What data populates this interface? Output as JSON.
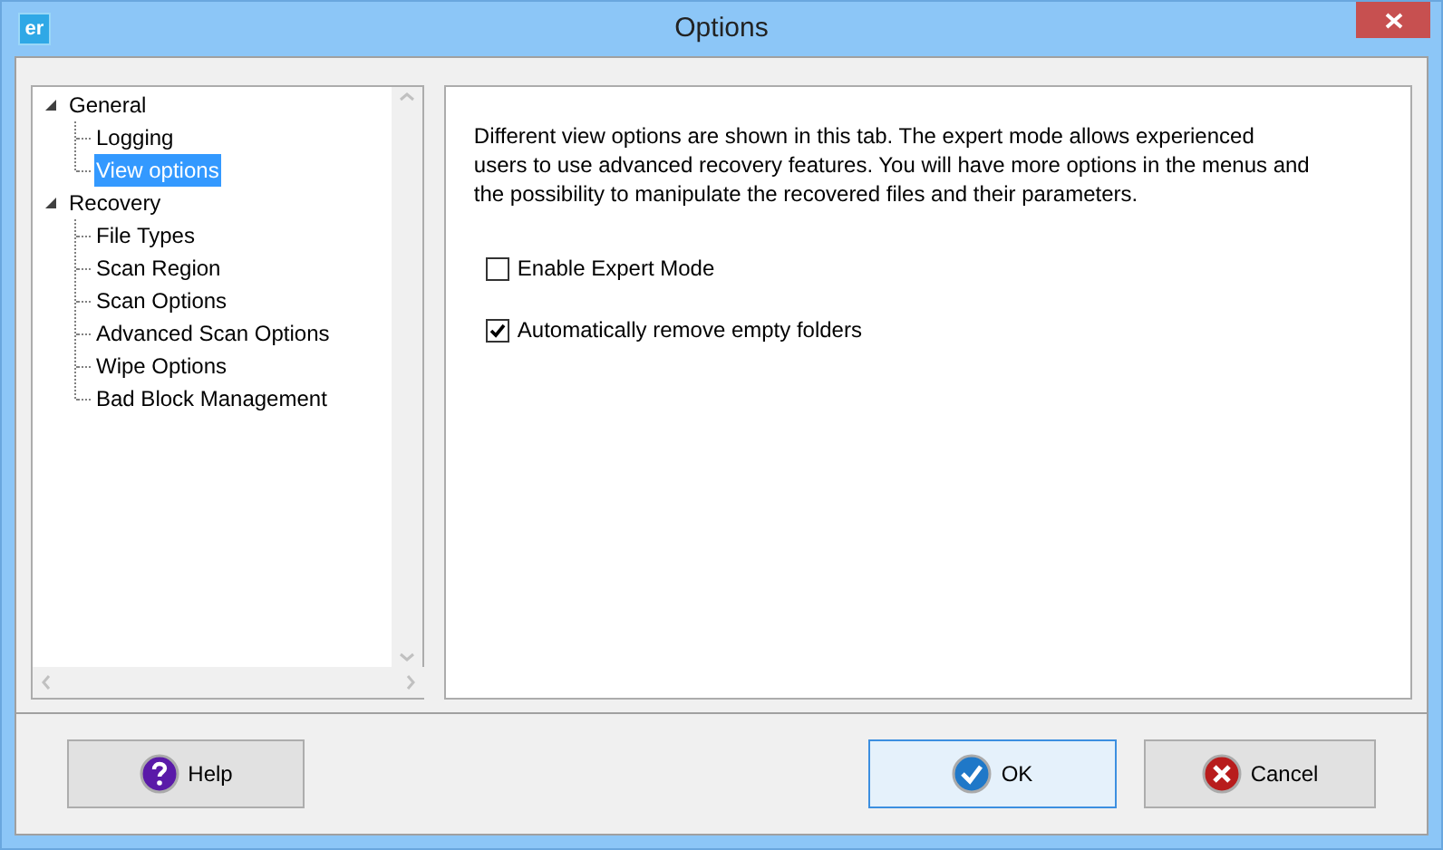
{
  "window": {
    "title": "Options",
    "app_icon_text": "er"
  },
  "tree": [
    {
      "label": "General",
      "expanded": true,
      "selected": false,
      "children": [
        {
          "label": "Logging",
          "selected": false
        },
        {
          "label": "View options",
          "selected": true
        }
      ]
    },
    {
      "label": "Recovery",
      "expanded": true,
      "selected": false,
      "children": [
        {
          "label": "File Types",
          "selected": false
        },
        {
          "label": "Scan Region",
          "selected": false
        },
        {
          "label": "Scan Options",
          "selected": false
        },
        {
          "label": "Advanced Scan Options",
          "selected": false
        },
        {
          "label": "Wipe Options",
          "selected": false
        },
        {
          "label": "Bad Block Management",
          "selected": false
        }
      ]
    }
  ],
  "description": "Different view options are shown in this tab. The expert mode allows experienced users to use advanced recovery features. You will have more options in the menus and the possibility to manipulate the recovered files and their parameters.",
  "options": [
    {
      "label": "Enable Expert Mode",
      "checked": false
    },
    {
      "label": "Automatically remove empty folders",
      "checked": true
    }
  ],
  "buttons": [
    {
      "label": "Help",
      "kind": "help",
      "focused": false
    },
    {
      "label": "OK",
      "kind": "ok",
      "focused": true
    },
    {
      "label": "Cancel",
      "kind": "cancel",
      "focused": false
    }
  ]
}
